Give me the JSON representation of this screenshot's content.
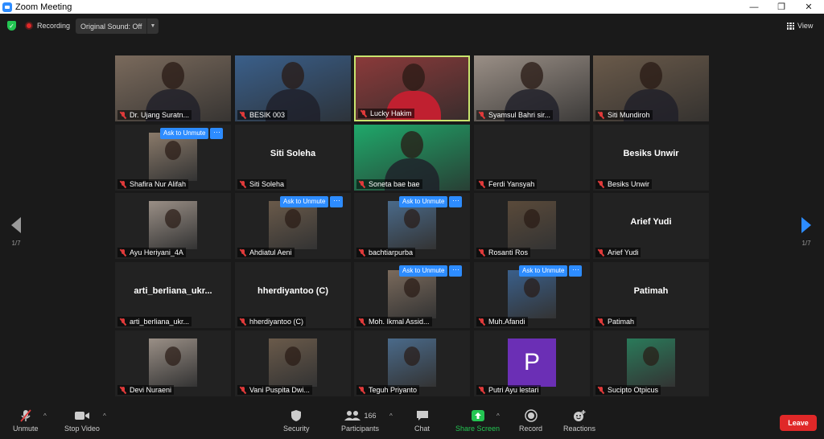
{
  "window": {
    "title": "Zoom Meeting"
  },
  "topbar": {
    "recording_label": "Recording",
    "original_sound_label": "Original Sound: Off",
    "view_label": "View"
  },
  "page_indicator": {
    "left": "1/7",
    "right": "1/7"
  },
  "ask_to_unmute_label": "Ask to Unmute",
  "more_label": "···",
  "participants": [
    {
      "name": "Dr. Ujang Suratn...",
      "video": true
    },
    {
      "name": "BESIK 003",
      "video": true
    },
    {
      "name": "Lucky Hakim",
      "video": true,
      "active_speaker": true
    },
    {
      "name": "Syamsul Bahri sir...",
      "video": true
    },
    {
      "name": "Siti Mundiroh",
      "video": true
    },
    {
      "name": "Shafira Nur Alifah",
      "video": true,
      "ask_unmute": true
    },
    {
      "name": "Siti Soleha",
      "display_name": "Siti Soleha",
      "video": false
    },
    {
      "name": "Soneta bae bae",
      "video": true
    },
    {
      "name": "Ferdi Yansyah",
      "video": false
    },
    {
      "name": "Besiks Unwir",
      "display_name": "Besiks Unwir",
      "video": false
    },
    {
      "name": "Ayu Heriyani_4A",
      "video": true
    },
    {
      "name": "Ahdiatul Aeni",
      "video": true,
      "ask_unmute": true
    },
    {
      "name": "bachtiarpurba",
      "video": true,
      "ask_unmute": true
    },
    {
      "name": "Rosanti Ros",
      "video": true
    },
    {
      "name": "Arief Yudi",
      "display_name": "Arief Yudi",
      "video": false
    },
    {
      "name": "arti_berliana_ukr...",
      "display_name": "arti_berliana_ukr...",
      "video": false
    },
    {
      "name": "hherdiyantoo (C)",
      "display_name": "hherdiyantoo (C)",
      "video": false
    },
    {
      "name": "Moh. Ikmal Assid...",
      "video": true,
      "ask_unmute": true
    },
    {
      "name": "Muh.Afandi",
      "video": true,
      "ask_unmute": true
    },
    {
      "name": "Patimah",
      "display_name": "Patimah",
      "video": false
    },
    {
      "name": "Devi Nuraeni",
      "video": true
    },
    {
      "name": "Vani Puspita Dwi...",
      "video": true
    },
    {
      "name": "Teguh Priyanto",
      "video": true
    },
    {
      "name": "Putri Ayu lestari",
      "video": true,
      "avatar_letter": "P",
      "avatar_color": "#6b2fb5"
    },
    {
      "name": "Sucipto Otpicus",
      "video": true
    }
  ],
  "toolbar": {
    "unmute": "Unmute",
    "stop_video": "Stop Video",
    "security": "Security",
    "participants": "Participants",
    "participants_count": "166",
    "chat": "Chat",
    "share_screen": "Share Screen",
    "record": "Record",
    "reactions": "Reactions",
    "leave": "Leave"
  },
  "colors": {
    "accent": "#2d8cff",
    "active_speaker": "#c9e46e",
    "leave": "#e02828",
    "share": "#23c552"
  }
}
